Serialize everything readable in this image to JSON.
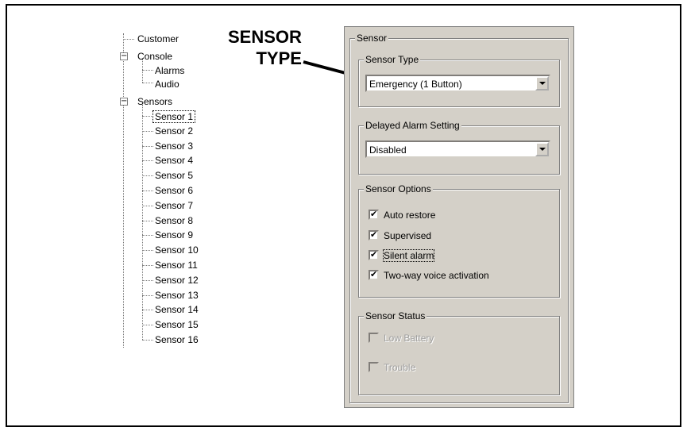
{
  "callout": {
    "line1": "SENSOR",
    "line2": "TYPE"
  },
  "tree": {
    "customer": "Customer",
    "console": "Console",
    "console_children": [
      "Alarms",
      "Audio"
    ],
    "sensors": "Sensors",
    "sensor_items": [
      "Sensor 1",
      "Sensor 2",
      "Sensor 3",
      "Sensor 4",
      "Sensor 5",
      "Sensor 6",
      "Sensor 7",
      "Sensor 8",
      "Sensor 9",
      "Sensor 10",
      "Sensor 11",
      "Sensor 12",
      "Sensor 13",
      "Sensor 14",
      "Sensor 15",
      "Sensor 16"
    ],
    "selected": "Sensor 1"
  },
  "panel": {
    "title": "Sensor",
    "sensor_type": {
      "label": "Sensor Type",
      "value": "Emergency (1 Button)"
    },
    "delayed_alarm": {
      "label": "Delayed Alarm Setting",
      "value": "Disabled"
    },
    "options": {
      "label": "Sensor Options",
      "auto_restore": "Auto restore",
      "supervised": "Supervised",
      "silent_alarm": "Silent alarm",
      "two_way": "Two-way voice activation"
    },
    "status": {
      "label": "Sensor Status",
      "low_battery": "Low Battery",
      "trouble": "Trouble"
    }
  }
}
